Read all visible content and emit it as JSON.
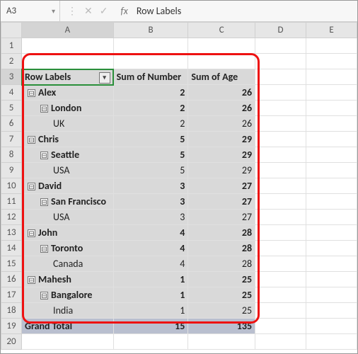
{
  "formula_bar": {
    "name_box": "A3",
    "fx_label": "fx",
    "value": "Row Labels"
  },
  "columns": [
    "A",
    "B",
    "C",
    "D",
    "E"
  ],
  "row_numbers": [
    1,
    2,
    3,
    4,
    5,
    6,
    7,
    8,
    9,
    10,
    11,
    12,
    13,
    14,
    15,
    16,
    17,
    18,
    19,
    20
  ],
  "active_cell": "A3",
  "pivot": {
    "header": {
      "row_labels": "Row Labels",
      "col1": "Sum of Number",
      "col2": "Sum of Age"
    },
    "groups": [
      {
        "name": "Alex",
        "num": 2,
        "age": 26,
        "city": "London",
        "cnum": 2,
        "cage": 26,
        "country": "UK",
        "knum": 2,
        "kage": 26
      },
      {
        "name": "Chris",
        "num": 5,
        "age": 29,
        "city": "Seattle",
        "cnum": 5,
        "cage": 29,
        "country": "USA",
        "knum": 5,
        "kage": 29
      },
      {
        "name": "David",
        "num": 3,
        "age": 27,
        "city": "San Francisco",
        "cnum": 3,
        "cage": 27,
        "country": "USA",
        "knum": 3,
        "kage": 27
      },
      {
        "name": "John",
        "num": 4,
        "age": 28,
        "city": "Toronto",
        "cnum": 4,
        "cage": 28,
        "country": "Canada",
        "knum": 4,
        "kage": 28
      },
      {
        "name": "Mahesh",
        "num": 1,
        "age": 25,
        "city": "Bangalore",
        "cnum": 1,
        "cage": 25,
        "country": "India",
        "knum": 1,
        "kage": 25
      }
    ],
    "grand_total": {
      "label": "Grand Total",
      "num": 15,
      "age": 135
    }
  },
  "icons": {
    "collapse": "⊟",
    "filter": "▾",
    "name_drop": "▾",
    "dots": "⋮",
    "cancel": "✕",
    "accept": "✓"
  }
}
